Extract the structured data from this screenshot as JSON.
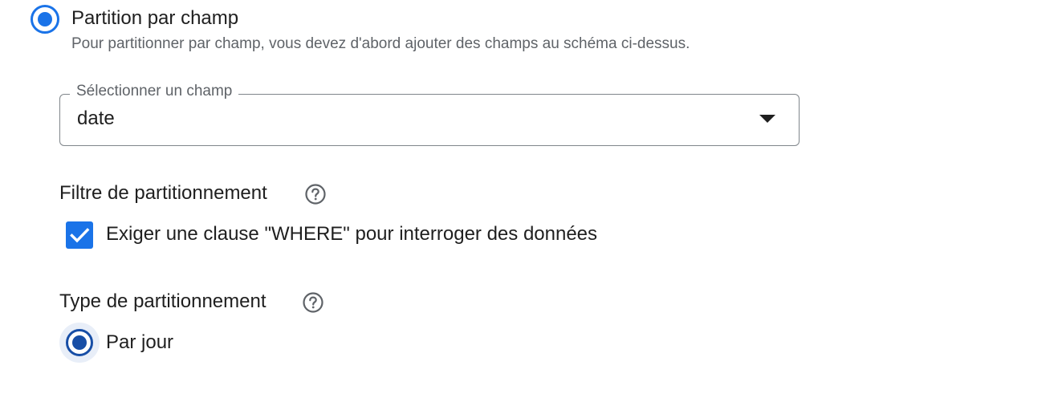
{
  "partition_option": {
    "label": "Partition par champ",
    "helper": "Pour partitionner par champ, vous devez d'abord ajouter des champs au schéma ci-dessus.",
    "selected": true
  },
  "field_select": {
    "legend": "Sélectionner un champ",
    "value": "date",
    "icon": "arrow-drop-down-icon"
  },
  "filter_section": {
    "title": "Filtre de partitionnement",
    "help_icon": "help-circle-icon",
    "checkbox_label": "Exiger une clause \"WHERE\" pour interroger des données",
    "checked": true
  },
  "type_section": {
    "title": "Type de partitionnement",
    "help_icon": "help-circle-icon",
    "option_label": "Par jour",
    "selected": true
  },
  "colors": {
    "accent": "#1a73e8",
    "accent_dark": "#174ea6",
    "text": "#1f1f1f",
    "secondary_text": "#5f6368",
    "border": "#80868b"
  }
}
